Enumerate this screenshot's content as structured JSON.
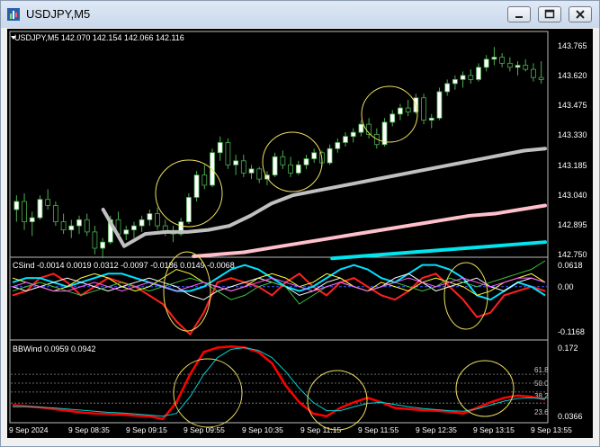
{
  "window": {
    "title": "USDJPY,M5"
  },
  "main_panel": {
    "header": "USDJPY,M5  142.070 142.154 142.066 142.116",
    "price_labels": [
      "143.765",
      "143.620",
      "143.475",
      "143.330",
      "143.185",
      "143.040",
      "142.895",
      "142.750"
    ]
  },
  "csind_panel": {
    "header": "CSind -0.0014 0.0019 0.0312 -0.0097 -0.0186 0.0149 -0.0068",
    "scale_labels": [
      "0.0618",
      "0.00",
      "-0.1168"
    ]
  },
  "bbwind_panel": {
    "header": "BBWind 0.0959 0.0942",
    "scale_labels": [
      "0.172",
      "0.0366"
    ],
    "level_labels": [
      "61.8",
      "50.0",
      "38.2",
      "23.6"
    ]
  },
  "time_axis": {
    "labels": [
      "9 Sep 2024",
      "9 Sep 08:35",
      "9 Sep 09:15",
      "9 Sep 09:55",
      "9 Sep 10:35",
      "9 Sep 11:15",
      "9 Sep 11:55",
      "9 Sep 12:35",
      "9 Sep 13:15",
      "9 Sep 13:55"
    ]
  },
  "colors": {
    "background": "#000000",
    "bull_candle": "#ffffff",
    "candle_outline": "#4caf50",
    "ma_gray": "#c0c0c0",
    "ma_pink": "#ffc0cb",
    "ma_cyan": "#00e5ee",
    "bbwind_fast": "#ff0000",
    "bbwind_slow": "#00d0d0",
    "annotation_circle": "#f0e060"
  },
  "chart_data": [
    {
      "type": "candlestick",
      "title": "USDJPY,M5",
      "symbol": "USDJPY",
      "timeframe": "M5",
      "ohlc_last": {
        "open": 142.07,
        "high": 142.154,
        "low": 142.066,
        "close": 142.116
      },
      "ylim": [
        142.75,
        143.79
      ],
      "candles": [
        [
          142.98,
          143.05,
          142.92,
          143.02
        ],
        [
          143.02,
          143.06,
          142.88,
          142.92
        ],
        [
          142.92,
          142.97,
          142.85,
          142.94
        ],
        [
          142.94,
          143.05,
          142.93,
          143.03
        ],
        [
          143.03,
          143.08,
          142.98,
          143.0
        ],
        [
          143.0,
          143.02,
          142.9,
          142.92
        ],
        [
          142.92,
          142.96,
          142.86,
          142.88
        ],
        [
          142.88,
          142.93,
          142.84,
          142.9
        ],
        [
          142.9,
          142.95,
          142.86,
          142.93
        ],
        [
          142.93,
          142.96,
          142.85,
          142.87
        ],
        [
          142.87,
          142.9,
          142.76,
          142.79
        ],
        [
          142.79,
          142.84,
          142.74,
          142.82
        ],
        [
          142.82,
          142.95,
          142.81,
          142.93
        ],
        [
          142.93,
          142.97,
          142.84,
          142.86
        ],
        [
          142.86,
          142.9,
          142.83,
          142.88
        ],
        [
          142.88,
          142.92,
          142.84,
          142.9
        ],
        [
          142.9,
          142.95,
          142.87,
          142.93
        ],
        [
          142.93,
          142.98,
          142.9,
          142.96
        ],
        [
          142.96,
          142.99,
          142.88,
          142.9
        ],
        [
          142.9,
          142.93,
          142.85,
          142.87
        ],
        [
          142.87,
          142.9,
          142.82,
          142.86
        ],
        [
          142.86,
          142.94,
          142.85,
          142.92
        ],
        [
          142.92,
          143.06,
          142.91,
          143.04
        ],
        [
          143.04,
          143.17,
          143.02,
          143.15
        ],
        [
          143.15,
          143.2,
          143.08,
          143.1
        ],
        [
          143.1,
          143.28,
          143.09,
          143.26
        ],
        [
          143.26,
          143.34,
          143.22,
          143.31
        ],
        [
          143.31,
          143.33,
          143.18,
          143.2
        ],
        [
          143.2,
          143.25,
          143.15,
          143.22
        ],
        [
          143.22,
          143.25,
          143.14,
          143.16
        ],
        [
          143.16,
          143.2,
          143.13,
          143.18
        ],
        [
          143.18,
          143.19,
          143.11,
          143.13
        ],
        [
          143.13,
          143.17,
          143.1,
          143.15
        ],
        [
          143.15,
          143.26,
          143.14,
          143.24
        ],
        [
          143.24,
          143.27,
          143.18,
          143.2
        ],
        [
          143.2,
          143.24,
          143.14,
          143.16
        ],
        [
          143.16,
          143.22,
          143.15,
          143.2
        ],
        [
          143.2,
          143.25,
          143.18,
          143.23
        ],
        [
          143.23,
          143.28,
          143.21,
          143.26
        ],
        [
          143.26,
          143.27,
          143.19,
          143.21
        ],
        [
          143.21,
          143.3,
          143.2,
          143.28
        ],
        [
          143.28,
          143.33,
          143.26,
          143.31
        ],
        [
          143.31,
          143.36,
          143.29,
          143.34
        ],
        [
          143.34,
          143.38,
          143.31,
          143.36
        ],
        [
          143.36,
          143.42,
          143.34,
          143.4
        ],
        [
          143.4,
          143.43,
          143.33,
          143.35
        ],
        [
          143.35,
          143.38,
          143.28,
          143.3
        ],
        [
          143.3,
          143.43,
          143.29,
          143.41
        ],
        [
          143.41,
          143.47,
          143.39,
          143.45
        ],
        [
          143.45,
          143.5,
          143.42,
          143.48
        ],
        [
          143.48,
          143.52,
          143.44,
          143.46
        ],
        [
          143.46,
          143.55,
          143.45,
          143.53
        ],
        [
          143.53,
          143.55,
          143.4,
          143.42
        ],
        [
          143.42,
          143.45,
          143.38,
          143.43
        ],
        [
          143.43,
          143.58,
          143.42,
          143.56
        ],
        [
          143.56,
          143.62,
          143.54,
          143.6
        ],
        [
          143.6,
          143.64,
          143.57,
          143.62
        ],
        [
          143.62,
          143.66,
          143.58,
          143.64
        ],
        [
          143.64,
          143.67,
          143.6,
          143.62
        ],
        [
          143.62,
          143.7,
          143.61,
          143.68
        ],
        [
          143.68,
          143.74,
          143.66,
          143.72
        ],
        [
          143.72,
          143.78,
          143.69,
          143.73
        ],
        [
          143.73,
          143.75,
          143.68,
          143.7
        ],
        [
          143.7,
          143.73,
          143.66,
          143.68
        ],
        [
          143.68,
          143.71,
          143.64,
          143.69
        ],
        [
          143.69,
          143.72,
          143.66,
          143.67
        ],
        [
          143.67,
          143.7,
          143.61,
          143.63
        ],
        [
          143.63,
          143.71,
          143.6,
          143.62
        ]
      ],
      "moving_averages": [
        {
          "color": "#c0c0c0",
          "values": [
            142.98,
            142.8,
            142.86,
            142.87,
            142.87,
            142.88,
            142.9,
            142.95,
            143.01,
            143.05,
            143.07,
            143.09,
            143.11,
            143.13,
            143.15,
            143.17,
            143.19,
            143.21,
            143.23,
            143.25,
            143.27,
            143.28
          ]
        },
        {
          "color": "#ffc0cb",
          "values": [
            142.75,
            142.76,
            142.77,
            142.79,
            142.81,
            142.83,
            142.85,
            142.87,
            142.89,
            142.91,
            142.93,
            142.95,
            142.96,
            142.98,
            143.0
          ]
        },
        {
          "color": "#00e5ee",
          "values": [
            142.74,
            142.75,
            142.76,
            142.77,
            142.78,
            142.79,
            142.8,
            142.81,
            142.82
          ]
        }
      ]
    },
    {
      "type": "line",
      "title": "CSind",
      "values_last": [
        -0.0014,
        0.0019,
        0.0312,
        -0.0097,
        -0.0186,
        0.0149,
        -0.0068
      ],
      "ylim": [
        -0.1168,
        0.0618
      ],
      "series": [
        {
          "color": "#ff2020",
          "values": [
            -0.02,
            -0.01,
            0.02,
            0.03,
            0.01,
            -0.02,
            0.0,
            0.02,
            0.01,
            0.0,
            -0.02,
            -0.04,
            -0.08,
            -0.11,
            -0.06,
            0.01,
            0.02,
            0.01,
            0.0,
            -0.02,
            0.01,
            0.03,
            0.0,
            -0.02,
            0.01,
            0.02,
            0.0,
            -0.02,
            -0.03,
            -0.01,
            0.02,
            0.03,
            0.0,
            -0.03,
            -0.07,
            -0.06,
            -0.02,
            -0.01,
            0.0,
            -0.01
          ]
        },
        {
          "color": "#00e0ff",
          "values": [
            0.01,
            0.02,
            0.02,
            0.01,
            0.0,
            0.01,
            0.02,
            0.03,
            0.03,
            0.02,
            0.01,
            0.0,
            -0.01,
            -0.01,
            0.0,
            0.02,
            0.04,
            0.05,
            0.04,
            0.02,
            0.0,
            -0.01,
            0.0,
            0.02,
            0.04,
            0.05,
            0.04,
            0.02,
            0.01,
            0.03,
            0.05,
            0.05,
            0.04,
            0.02,
            -0.02,
            -0.03,
            -0.01,
            0.01,
            0.0,
            -0.02
          ]
        },
        {
          "color": "#ffffff",
          "values": [
            0.0,
            -0.01,
            0.0,
            0.01,
            0.02,
            0.01,
            0.0,
            -0.01,
            0.0,
            0.01,
            0.02,
            0.01,
            0.0,
            -0.02,
            -0.03,
            -0.01,
            0.0,
            0.01,
            0.02,
            0.01,
            0.0,
            -0.02,
            -0.01,
            0.01,
            0.02,
            0.0,
            -0.01,
            0.0,
            0.02,
            0.03,
            0.01,
            -0.01,
            0.0,
            0.01,
            0.02,
            0.0,
            -0.01,
            0.01,
            0.02,
            0.01
          ]
        },
        {
          "color": "#ffff40",
          "values": [
            0.02,
            0.01,
            0.0,
            -0.01,
            0.0,
            0.02,
            0.03,
            0.02,
            0.0,
            -0.01,
            0.0,
            0.02,
            0.04,
            0.03,
            0.01,
            0.0,
            -0.01,
            0.0,
            0.02,
            0.03,
            0.02,
            0.0,
            0.01,
            0.03,
            0.02,
            0.0,
            -0.01,
            0.01,
            0.0,
            -0.01,
            0.01,
            0.02,
            0.01,
            0.0,
            -0.02,
            -0.01,
            0.01,
            0.02,
            0.03,
            0.01
          ]
        },
        {
          "color": "#40c040",
          "values": [
            -0.01,
            0.0,
            0.01,
            0.0,
            -0.01,
            -0.02,
            -0.01,
            0.0,
            0.01,
            0.0,
            -0.01,
            0.0,
            0.01,
            0.02,
            0.01,
            -0.01,
            -0.03,
            -0.02,
            0.0,
            0.01,
            0.0,
            -0.04,
            -0.02,
            0.0,
            0.01,
            0.0,
            -0.01,
            0.0,
            0.01,
            0.0,
            -0.01,
            0.0,
            0.02,
            0.01,
            0.0,
            0.01,
            0.02,
            0.03,
            0.04,
            0.06
          ]
        },
        {
          "color": "#ff60ff",
          "values": [
            0.0,
            0.01,
            0.0,
            -0.01,
            -0.01,
            0.0,
            0.01,
            0.0,
            -0.01,
            0.0,
            0.01,
            0.0,
            -0.01,
            0.0,
            0.01,
            0.0,
            -0.01,
            0.0,
            0.01,
            0.02,
            0.01,
            0.0,
            -0.01,
            0.0,
            0.01,
            0.0,
            -0.01,
            0.0,
            0.01,
            0.02,
            0.01,
            0.0,
            0.01,
            0.02,
            0.01,
            0.0,
            0.01,
            0.02,
            0.02,
            0.01
          ]
        }
      ]
    },
    {
      "type": "line",
      "title": "BBWind",
      "values_last": [
        0.0959,
        0.0942
      ],
      "ylim": [
        0.0366,
        0.172
      ],
      "levels": [
        61.8,
        50.0,
        38.2,
        23.6
      ],
      "series": [
        {
          "color": "#ff0000",
          "values": [
            0.065,
            0.063,
            0.061,
            0.058,
            0.055,
            0.052,
            0.05,
            0.049,
            0.048,
            0.046,
            0.045,
            0.04,
            0.07,
            0.12,
            0.16,
            0.168,
            0.17,
            0.168,
            0.16,
            0.14,
            0.1,
            0.07,
            0.05,
            0.045,
            0.06,
            0.07,
            0.078,
            0.07,
            0.06,
            0.058,
            0.056,
            0.055,
            0.053,
            0.05,
            0.06,
            0.07,
            0.078,
            0.082,
            0.08,
            0.075
          ]
        },
        {
          "color": "#00d0d0",
          "values": [
            0.062,
            0.062,
            0.061,
            0.06,
            0.058,
            0.056,
            0.054,
            0.052,
            0.051,
            0.049,
            0.047,
            0.045,
            0.05,
            0.08,
            0.12,
            0.15,
            0.165,
            0.168,
            0.163,
            0.15,
            0.125,
            0.095,
            0.07,
            0.055,
            0.055,
            0.062,
            0.068,
            0.07,
            0.066,
            0.062,
            0.059,
            0.057,
            0.055,
            0.054,
            0.058,
            0.065,
            0.072,
            0.077,
            0.078,
            0.076
          ]
        }
      ]
    }
  ]
}
